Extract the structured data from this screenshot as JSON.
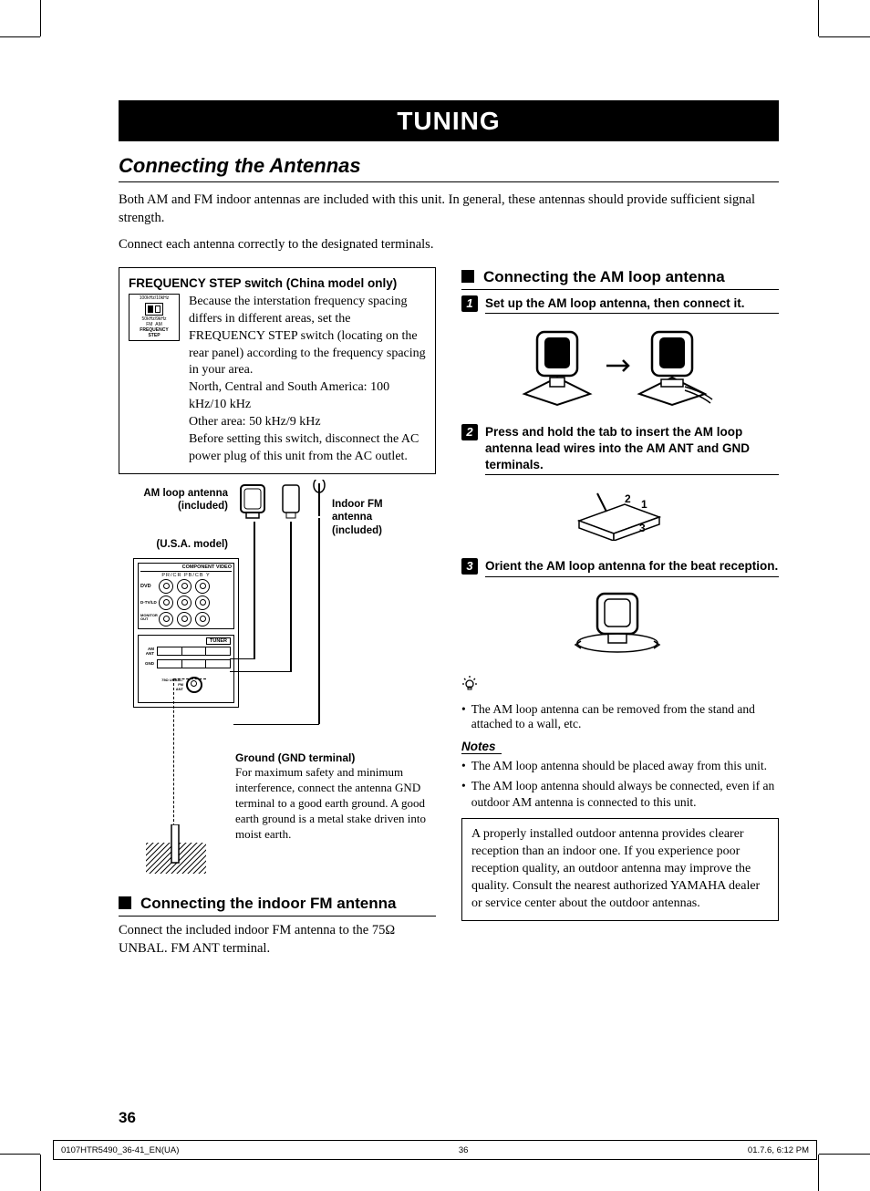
{
  "chapter": "TUNING",
  "section": "Connecting the Antennas",
  "intro1": "Both AM and FM indoor antennas are included with this unit. In general, these antennas should provide sufficient signal strength.",
  "intro2": "Connect each antenna correctly to the designated terminals.",
  "freq_box": {
    "title": "FREQUENCY STEP switch (China model only)",
    "body": "Because the interstation frequency spacing differs in different areas, set the FREQUENCY STEP switch (locating on the rear panel) according to the frequency spacing in your area.\nNorth, Central and South America: 100 kHz/10 kHz\nOther area: 50 kHz/9 kHz\nBefore setting this switch, disconnect the AC power plug of this unit from the AC outlet.",
    "fig_top": "100kHz/10kHz",
    "fig_mid": "50kHz/9kHz",
    "fig_fm": "FM",
    "fig_am": "AM",
    "fig_label": "FREQUENCY\nSTEP"
  },
  "diagram": {
    "am_loop_label": "AM loop antenna\n(included)",
    "fm_label": "Indoor FM\nantenna\n(included)",
    "usa_label": "(U.S.A. model)",
    "panel_header": "COMPONENT VIDEO",
    "panel_row": "PR/CR   PB/CB   Y",
    "panel_dvd": "DVD",
    "panel_dtv": "D-TV/LD",
    "panel_mon": "MONITOR\nOUT",
    "tuner": "TUNER",
    "am_ant": "AM\nANT",
    "gnd": "GND",
    "fm_ant": "75Ω UNBAL.",
    "fm_ant2": "FM\nANT",
    "gnd_title": "Ground (GND terminal)",
    "gnd_body": "For maximum safety and minimum interference, connect the antenna GND terminal to a good earth ground. A good earth ground is a metal stake driven into moist earth."
  },
  "fm_section": {
    "heading": "Connecting the indoor FM antenna",
    "body": "Connect the included indoor FM antenna to the 75Ω UNBAL. FM ANT terminal."
  },
  "am_section": {
    "heading": "Connecting the AM loop antenna",
    "step1": "Set up the AM loop antenna, then connect it.",
    "step2": "Press and hold the tab to insert the AM loop antenna lead wires into the AM ANT and GND terminals.",
    "step3": "Orient the AM loop antenna for the beat reception.",
    "tip": "The AM loop antenna can be removed from the stand and attached to a wall, etc.",
    "notes_hd": "Notes",
    "note1": "The AM loop antenna should be placed away from this unit.",
    "note2": "The AM loop antenna should always be connected, even if an outdoor AM antenna is connected to this unit.",
    "info": "A properly installed outdoor antenna provides clearer reception than an indoor one. If you experience poor reception quality, an outdoor antenna may improve the quality. Consult the nearest authorized YAMAHA dealer or service center about the outdoor antennas."
  },
  "page_number": "36",
  "footer": {
    "file": "0107HTR5490_36-41_EN(UA)",
    "page": "36",
    "date": "01.7.6, 6:12 PM"
  }
}
